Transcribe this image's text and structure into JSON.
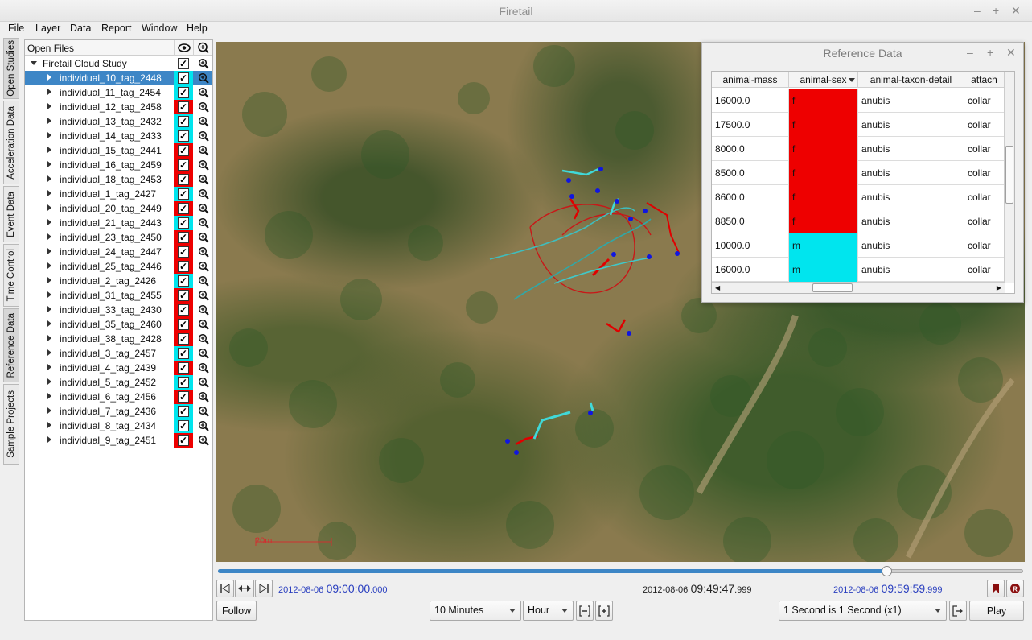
{
  "window": {
    "title": "Firetail"
  },
  "menu": [
    "File",
    "Layer",
    "Data",
    "Report",
    "Window",
    "Help"
  ],
  "side_tabs": [
    "Open Studies",
    "Acceleration Data",
    "Event Data",
    "Time Control",
    "Reference Data",
    "Sample Projects"
  ],
  "tree": {
    "header": "Open Files",
    "study": "Firetail Cloud Study",
    "items": [
      {
        "label": "individual_10_tag_2448",
        "sex_color": "#00e5ee",
        "selected": true
      },
      {
        "label": "individual_11_tag_2454",
        "sex_color": "#00e5ee"
      },
      {
        "label": "individual_12_tag_2458",
        "sex_color": "#ee0000"
      },
      {
        "label": "individual_13_tag_2432",
        "sex_color": "#00e5ee"
      },
      {
        "label": "individual_14_tag_2433",
        "sex_color": "#00e5ee"
      },
      {
        "label": "individual_15_tag_2441",
        "sex_color": "#ee0000"
      },
      {
        "label": "individual_16_tag_2459",
        "sex_color": "#ee0000"
      },
      {
        "label": "individual_18_tag_2453",
        "sex_color": "#ee0000"
      },
      {
        "label": "individual_1_tag_2427",
        "sex_color": "#00e5ee"
      },
      {
        "label": "individual_20_tag_2449",
        "sex_color": "#ee0000"
      },
      {
        "label": "individual_21_tag_2443",
        "sex_color": "#00e5ee"
      },
      {
        "label": "individual_23_tag_2450",
        "sex_color": "#ee0000"
      },
      {
        "label": "individual_24_tag_2447",
        "sex_color": "#ee0000"
      },
      {
        "label": "individual_25_tag_2446",
        "sex_color": "#ee0000"
      },
      {
        "label": "individual_2_tag_2426",
        "sex_color": "#00e5ee"
      },
      {
        "label": "individual_31_tag_2455",
        "sex_color": "#ee0000"
      },
      {
        "label": "individual_33_tag_2430",
        "sex_color": "#ee0000"
      },
      {
        "label": "individual_35_tag_2460",
        "sex_color": "#ee0000"
      },
      {
        "label": "individual_38_tag_2428",
        "sex_color": "#ee0000"
      },
      {
        "label": "individual_3_tag_2457",
        "sex_color": "#00e5ee"
      },
      {
        "label": "individual_4_tag_2439",
        "sex_color": "#ee0000"
      },
      {
        "label": "individual_5_tag_2452",
        "sex_color": "#00e5ee"
      },
      {
        "label": "individual_6_tag_2456",
        "sex_color": "#ee0000"
      },
      {
        "label": "individual_7_tag_2436",
        "sex_color": "#00e5ee"
      },
      {
        "label": "individual_8_tag_2434",
        "sex_color": "#00e5ee"
      },
      {
        "label": "individual_9_tag_2451",
        "sex_color": "#ee0000"
      }
    ]
  },
  "map": {
    "scale_label": "20m"
  },
  "time": {
    "start_date": "2012-08-06",
    "start_time": "09:00:00",
    "start_ms": ".000",
    "current_date": "2012-08-06",
    "current_time": "09:49:47",
    "current_ms": ".999",
    "end_date": "2012-08-06",
    "end_time": "09:59:59",
    "end_ms": ".999",
    "progress": 0.83
  },
  "controls": {
    "follow": "Follow",
    "window_size": "10 Minutes",
    "unit": "Hour",
    "speed": "1 Second is 1 Second (x1)",
    "play": "Play"
  },
  "reference": {
    "title": "Reference Data",
    "columns": [
      "animal-mass",
      "animal-sex",
      "animal-taxon-detail",
      "attach"
    ],
    "rows": [
      {
        "mass": "16000.0",
        "sex": "f",
        "taxon": "anubis",
        "attach": "collar",
        "color": "#ee0000"
      },
      {
        "mass": "17500.0",
        "sex": "f",
        "taxon": "anubis",
        "attach": "collar",
        "color": "#ee0000"
      },
      {
        "mass": "8000.0",
        "sex": "f",
        "taxon": "anubis",
        "attach": "collar",
        "color": "#ee0000"
      },
      {
        "mass": "8500.0",
        "sex": "f",
        "taxon": "anubis",
        "attach": "collar",
        "color": "#ee0000"
      },
      {
        "mass": "8600.0",
        "sex": "f",
        "taxon": "anubis",
        "attach": "collar",
        "color": "#ee0000"
      },
      {
        "mass": "8850.0",
        "sex": "f",
        "taxon": "anubis",
        "attach": "collar",
        "color": "#ee0000"
      },
      {
        "mass": "10000.0",
        "sex": "m",
        "taxon": "anubis",
        "attach": "collar",
        "color": "#00e5ee"
      },
      {
        "mass": "16000.0",
        "sex": "m",
        "taxon": "anubis",
        "attach": "collar",
        "color": "#00e5ee"
      }
    ]
  }
}
